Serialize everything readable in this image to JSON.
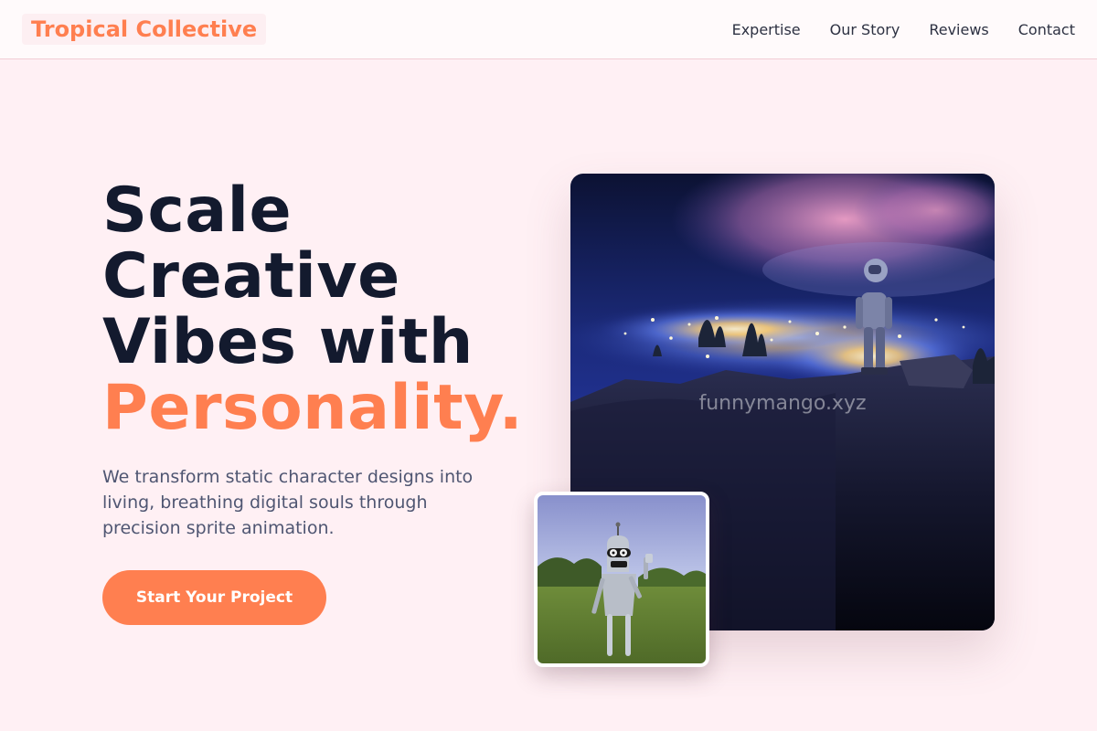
{
  "brand": {
    "name": "Tropical Collective"
  },
  "nav": {
    "items": [
      {
        "label": "Expertise"
      },
      {
        "label": "Our Story"
      },
      {
        "label": "Reviews"
      },
      {
        "label": "Contact"
      }
    ]
  },
  "hero": {
    "title_lines": [
      "Scale",
      "Creative",
      "Vibes with"
    ],
    "title_accent": "Personality.",
    "subtitle": "We transform static character designs into living, breathing digital souls through precision sprite animation.",
    "cta_label": "Start Your Project"
  },
  "images": {
    "main": {
      "subject": "astronaut on cliff overlooking glowing city at night",
      "watermark": "funnymango.xyz"
    },
    "thumb": {
      "subject": "robot character standing in grassy field"
    }
  },
  "colors": {
    "accent": "#ff7f50",
    "heading": "#131a2e",
    "background": "#fff0f4",
    "nav_background": "#fffafb",
    "body_text": "#4f5672"
  }
}
